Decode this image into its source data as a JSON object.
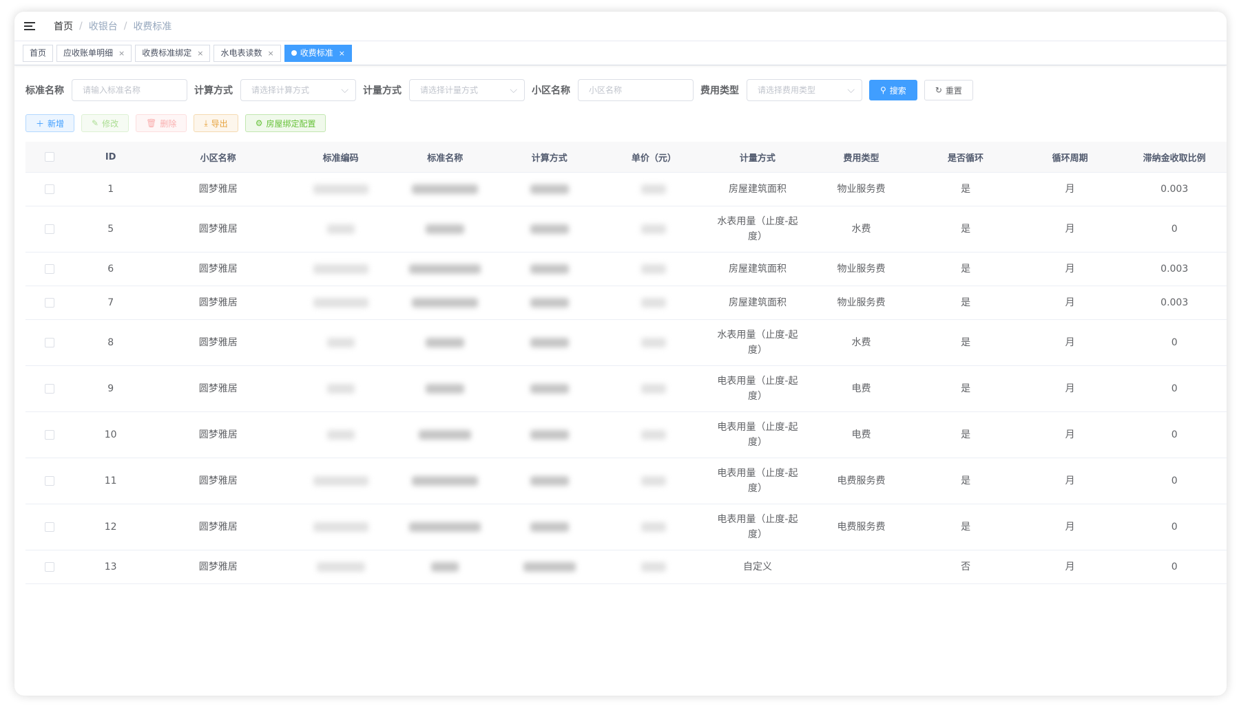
{
  "breadcrumb": [
    "首页",
    "收银台",
    "收费标准"
  ],
  "tabs": [
    {
      "label": "首页",
      "closable": false,
      "active": false
    },
    {
      "label": "应收账单明细",
      "closable": true,
      "active": false
    },
    {
      "label": "收费标准绑定",
      "closable": true,
      "active": false
    },
    {
      "label": "水电表读数",
      "closable": true,
      "active": false
    },
    {
      "label": "收费标准",
      "closable": true,
      "active": true
    }
  ],
  "search": {
    "name_label": "标准名称",
    "name_placeholder": "请输入标准名称",
    "calc_label": "计算方式",
    "calc_placeholder": "请选择计算方式",
    "meas_label": "计量方式",
    "meas_placeholder": "请选择计量方式",
    "comm_label": "小区名称",
    "comm_placeholder": "小区名称",
    "fee_label": "费用类型",
    "fee_placeholder": "请选择费用类型",
    "search_btn": "搜索",
    "reset_btn": "重置"
  },
  "toolbar": {
    "add": "新增",
    "edit": "修改",
    "delete": "删除",
    "export": "导出",
    "bind": "房屋绑定配置"
  },
  "table": {
    "headers": {
      "id": "ID",
      "community": "小区名称",
      "code": "标准编码",
      "name": "标准名称",
      "calc": "计算方式",
      "price": "单价（元）",
      "measure": "计量方式",
      "fee_type": "费用类型",
      "loop": "是否循环",
      "period": "循环周期",
      "late_rate": "滞纳金收取比例"
    },
    "rows": [
      {
        "id": "1",
        "community": "圆梦雅居",
        "measure": "房屋建筑面积",
        "fee_type": "物业服务费",
        "loop": "是",
        "period": "月",
        "late_rate": "0.003"
      },
      {
        "id": "5",
        "community": "圆梦雅居",
        "measure": "水表用量（止度-起度）",
        "fee_type": "水费",
        "loop": "是",
        "period": "月",
        "late_rate": "0"
      },
      {
        "id": "6",
        "community": "圆梦雅居",
        "measure": "房屋建筑面积",
        "fee_type": "物业服务费",
        "loop": "是",
        "period": "月",
        "late_rate": "0.003"
      },
      {
        "id": "7",
        "community": "圆梦雅居",
        "measure": "房屋建筑面积",
        "fee_type": "物业服务费",
        "loop": "是",
        "period": "月",
        "late_rate": "0.003"
      },
      {
        "id": "8",
        "community": "圆梦雅居",
        "measure": "水表用量（止度-起度）",
        "fee_type": "水费",
        "loop": "是",
        "period": "月",
        "late_rate": "0"
      },
      {
        "id": "9",
        "community": "圆梦雅居",
        "measure": "电表用量（止度-起度）",
        "fee_type": "电费",
        "loop": "是",
        "period": "月",
        "late_rate": "0"
      },
      {
        "id": "10",
        "community": "圆梦雅居",
        "measure": "电表用量（止度-起度）",
        "fee_type": "电费",
        "loop": "是",
        "period": "月",
        "late_rate": "0"
      },
      {
        "id": "11",
        "community": "圆梦雅居",
        "measure": "电表用量（止度-起度）",
        "fee_type": "电费服务费",
        "loop": "是",
        "period": "月",
        "late_rate": "0"
      },
      {
        "id": "12",
        "community": "圆梦雅居",
        "measure": "电表用量（止度-起度）",
        "fee_type": "电费服务费",
        "loop": "是",
        "period": "月",
        "late_rate": "0"
      },
      {
        "id": "13",
        "community": "圆梦雅居",
        "measure": "自定义",
        "fee_type": "",
        "loop": "否",
        "period": "月",
        "late_rate": "0"
      }
    ]
  },
  "colors": {
    "primary": "#409eff",
    "success": "#67c23a",
    "danger": "#f56c6c",
    "warning": "#e6a23c"
  }
}
